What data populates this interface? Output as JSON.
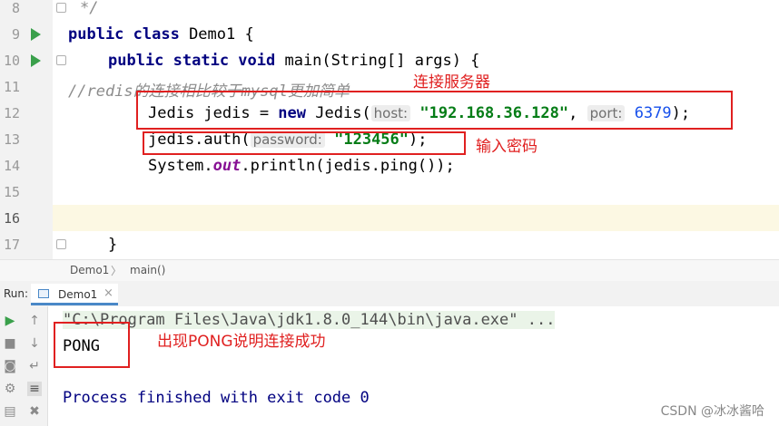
{
  "editor": {
    "line_numbers": [
      "8",
      "9",
      "10",
      "11",
      "12",
      "13",
      "14",
      "15",
      "16",
      "17"
    ],
    "line8": "*/",
    "line9": {
      "kw": "public class",
      "rest": " Demo1 {"
    },
    "line10": {
      "kw": "public static void",
      "rest": " main(String[] args) {"
    },
    "line11": "//redis的连接相比较于mysql更加简单",
    "line12": {
      "part1": "Jedis jedis = ",
      "kw": "new",
      "part2": " Jedis(",
      "hint_host": "host:",
      "host": "\"192.168.36.128\"",
      "comma": ",",
      "hint_port": "port:",
      "port": "6379",
      "end": ");"
    },
    "line13": {
      "part1": "jedis.auth(",
      "hint": "password:",
      "value": "\"123456\"",
      "end": ");"
    },
    "line14": {
      "part1": "System.",
      "field": "out",
      "part2": ".println(jedis.ping());"
    },
    "line17": "}"
  },
  "annotations": {
    "connect": "连接服务器",
    "password": "输入密码",
    "pong": "出现PONG说明连接成功"
  },
  "breadcrumb": {
    "class": "Demo1",
    "method": "main()",
    "sep": "〉"
  },
  "run_panel": {
    "label": "Run:",
    "tab": "Demo1",
    "tab_close": "×",
    "console": {
      "cmd": "\"C:\\Program Files\\Java\\jdk1.8.0_144\\bin\\java.exe\" ...",
      "output": "PONG",
      "exit": "Process finished with exit code 0"
    }
  },
  "watermark": "CSDN @冰冰酱哈",
  "icons": [
    "run-icon",
    "stop-icon",
    "camera-icon",
    "settings-icon",
    "print-icon",
    "up-arrow-icon",
    "down-arrow-icon",
    "wrap-icon",
    "sort-icon",
    "delete-icon"
  ],
  "colors": {
    "keyword": "#000080",
    "string": "#067d17",
    "number": "#1750eb",
    "annotation": "#e02020",
    "run_green": "#3aa04b"
  }
}
